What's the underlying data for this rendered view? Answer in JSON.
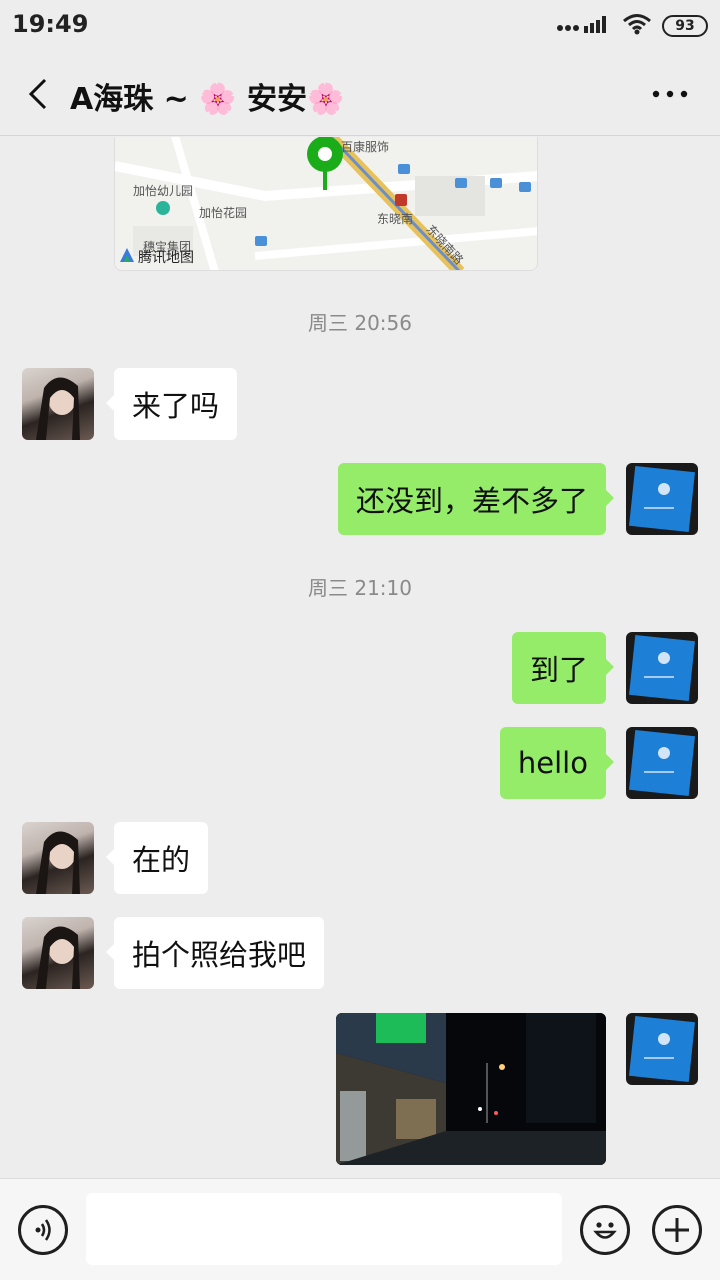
{
  "status_bar": {
    "time": "19:49",
    "battery": "93"
  },
  "header": {
    "title": "A海珠 ~ 🌸 安安🌸"
  },
  "map": {
    "labels": [
      "加怡幼儿园",
      "加怡花园",
      "东晓南",
      "东晓南路",
      "穗宝集团",
      "百康服饰"
    ],
    "provider": "腾讯地图"
  },
  "messages": [
    {
      "type": "timestamp",
      "text": "周三 20:56"
    },
    {
      "type": "text",
      "from": "them",
      "text": "来了吗"
    },
    {
      "type": "text",
      "from": "me",
      "text": "还没到，差不多了"
    },
    {
      "type": "timestamp",
      "text": "周三 21:10"
    },
    {
      "type": "text",
      "from": "me",
      "text": "到了"
    },
    {
      "type": "text",
      "from": "me",
      "text": "hello"
    },
    {
      "type": "text",
      "from": "them",
      "text": "在的"
    },
    {
      "type": "text",
      "from": "them",
      "text": "拍个照给我吧"
    },
    {
      "type": "image",
      "from": "me"
    }
  ],
  "input": {
    "value": "",
    "placeholder": ""
  },
  "icons": {
    "back": "back-arrow-icon",
    "more": "more-dots-icon",
    "voice": "voice-icon",
    "emoji": "emoji-icon",
    "plus": "plus-icon"
  },
  "colors": {
    "background": "#ededed",
    "bubble_out": "#95ec69",
    "bubble_in": "#ffffff",
    "map_pin": "#1aad19"
  }
}
